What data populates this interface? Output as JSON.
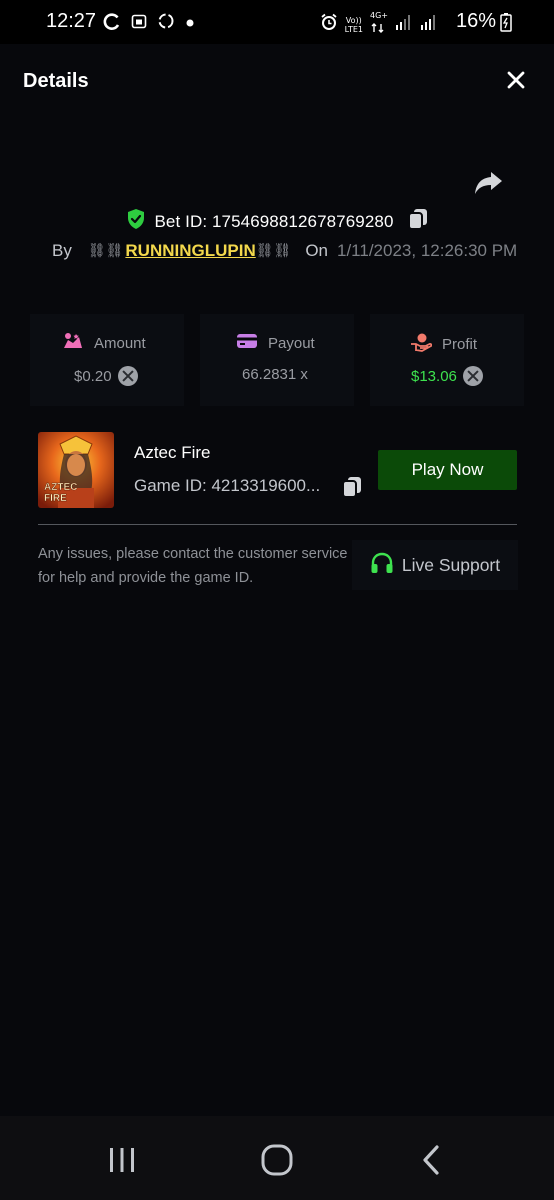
{
  "status_bar": {
    "time": "12:27",
    "battery": "16%",
    "network_lines": [
      "Vo))",
      "LTE1"
    ],
    "signal_label": "4G+",
    "left_icons": [
      "sync-icon",
      "calendar-icon",
      "recycle-icon",
      "dot-icon"
    ],
    "right_icons": [
      "alarm-icon",
      "volte-icon",
      "signal-icon",
      "signal-icon",
      "battery-icon"
    ]
  },
  "header": {
    "title": "Details",
    "close_icon": "close-icon"
  },
  "bet": {
    "id_text": "Bet ID: 1754698812678769280",
    "by_label": "By",
    "chain_left": "⛓",
    "username": "RUNNINGLUPIN",
    "chain_right": "⛓",
    "on_label": "On",
    "datetime": "1/11/2023, 12:26:30 PM",
    "verified_icon": "shield-check-icon",
    "share_icon": "share-icon",
    "copy_icon": "copy-icon"
  },
  "stats": {
    "amount": {
      "label": "Amount",
      "value": "$0.20",
      "icon": "amount-icon",
      "currency_icon": "coin-icon"
    },
    "payout": {
      "label": "Payout",
      "value": "66.2831 x",
      "icon": "card-icon"
    },
    "profit": {
      "label": "Profit",
      "value": "$13.06",
      "icon": "hand-coin-icon",
      "currency_icon": "coin-icon"
    }
  },
  "game": {
    "name": "Aztec Fire",
    "id_text": "Game ID: 4213319600...",
    "thumb_title_line1": "AZTEC",
    "thumb_title_line2": "FIRE",
    "play_label": "Play Now"
  },
  "support": {
    "message": "Any issues, please contact the customer service for help and provide the game ID.",
    "button_label": "Live Support",
    "icon": "headset-icon"
  },
  "nav": {
    "icons": [
      "recent-apps-icon",
      "home-icon",
      "back-icon"
    ]
  },
  "colors": {
    "background": "#07080c",
    "accent_green": "#2ecc40",
    "profit_green": "#3ee24f",
    "username_yellow": "#f3d84c",
    "play_button": "#0b4a08",
    "amount_icon": "#f06fb8",
    "payout_icon": "#c77ee6",
    "profit_icon": "#f27a6b"
  }
}
